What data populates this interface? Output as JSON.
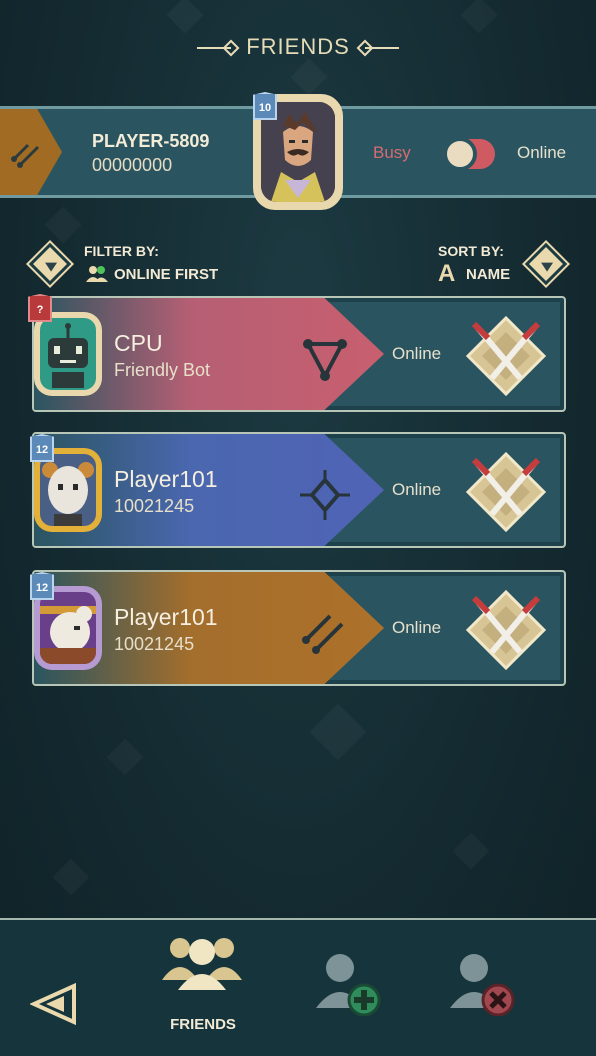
{
  "header": {
    "title": "FRIENDS"
  },
  "player": {
    "name": "PLAYER-5809",
    "id": "00000000",
    "level": "10",
    "status_busy_label": "Busy",
    "status_online_label": "Online"
  },
  "filter": {
    "label": "FILTER BY:",
    "value": "ONLINE FIRST"
  },
  "sort": {
    "label": "SORT BY:",
    "value": "NAME",
    "icon_letter": "A"
  },
  "friends": [
    {
      "name": "CPU",
      "subtitle": "Friendly Bot",
      "status": "Online",
      "badge": "?",
      "band_color": "#c65f73",
      "avatar": "robot-avatar",
      "rank_icon": "triangle-rank-icon"
    },
    {
      "name": "Player101",
      "subtitle": "10021245",
      "status": "Online",
      "badge": "12",
      "band_color": "#4d64b3",
      "avatar": "goat-avatar",
      "rank_icon": "diamond-rank-icon"
    },
    {
      "name": "Player101",
      "subtitle": "10021245",
      "status": "Online",
      "badge": "12",
      "band_color": "#a96f2a",
      "avatar": "rat-avatar",
      "rank_icon": "circuit-rank-icon"
    }
  ],
  "nav": {
    "friends_label": "FRIENDS",
    "icons": [
      "back-arrow-icon",
      "friends-icon",
      "add-friend-icon",
      "remove-friend-icon"
    ]
  },
  "colors": {
    "accent": "#e9d9ad",
    "busy": "#d86a70",
    "panel": "#2a5560"
  }
}
